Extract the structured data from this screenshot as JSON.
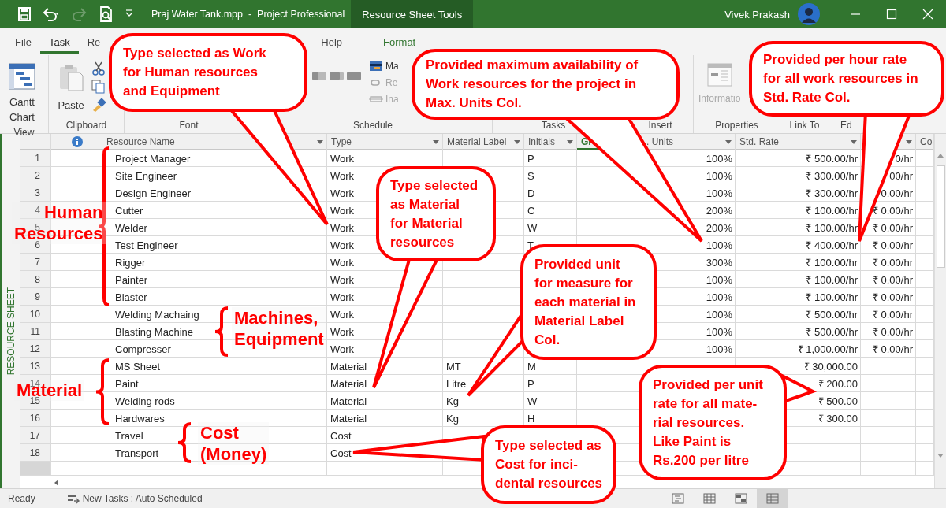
{
  "title_bar": {
    "document_title": "Praj Water Tank.mpp  -  Project Professional",
    "context_tab": "Resource Sheet Tools",
    "user_name": "Vivek Prakash"
  },
  "ribbon": {
    "tabs": [
      {
        "label": "File",
        "selected": false,
        "contextual": false
      },
      {
        "label": "Task",
        "selected": true,
        "contextual": false
      },
      {
        "label": "Re",
        "selected": false,
        "contextual": false
      },
      {
        "label": "Help",
        "selected": false,
        "contextual": false
      },
      {
        "label": "Format",
        "selected": false,
        "contextual": true
      }
    ],
    "groups": [
      {
        "label": "View"
      },
      {
        "label": "Clipboard"
      },
      {
        "label": "Font"
      },
      {
        "label": "Schedule"
      },
      {
        "label": "Tasks"
      },
      {
        "label": "Insert"
      },
      {
        "label": "Properties"
      },
      {
        "label": "Link To"
      },
      {
        "label": "Ed"
      }
    ],
    "commands": {
      "gantt_chart": "Gantt Chart",
      "paste": "Paste",
      "mark_on_track": "Ma",
      "respect_links": "Re",
      "inactivate": "Ina",
      "information": "Informatio"
    }
  },
  "view_label": "RESOURCE SHEET",
  "table": {
    "columns": {
      "resource_name": "Resource Name",
      "type": "Type",
      "material_label": "Material Label",
      "initials": "Initials",
      "group": "Gr",
      "max_units": ". Units",
      "std_rate": "Std. Rate",
      "column_10": "Co"
    },
    "rows": [
      {
        "id": "1",
        "name": "Project Manager",
        "type": "Work",
        "initials": "P",
        "max_units": "100%",
        "std_rate": "₹ 500.00/hr",
        "ovt_rate": "0/hr"
      },
      {
        "id": "2",
        "name": "Site Engineer",
        "type": "Work",
        "initials": "S",
        "max_units": "100%",
        "std_rate": "₹ 300.00/hr",
        "ovt_rate": "00/hr"
      },
      {
        "id": "3",
        "name": "Design Engineer",
        "type": "Work",
        "initials": "D",
        "max_units": "100%",
        "std_rate": "₹ 300.00/hr",
        "ovt_rate": "0.00/hr"
      },
      {
        "id": "4",
        "name": "Cutter",
        "type": "Work",
        "initials": "C",
        "max_units": "200%",
        "std_rate": "₹ 100.00/hr",
        "ovt_rate": "₹ 0.00/hr"
      },
      {
        "id": "5",
        "name": "Welder",
        "type": "Work",
        "initials": "W",
        "max_units": "200%",
        "std_rate": "₹ 100.00/hr",
        "ovt_rate": "₹ 0.00/hr"
      },
      {
        "id": "6",
        "name": "Test Engineer",
        "type": "Work",
        "initials": "T",
        "max_units": "100%",
        "std_rate": "₹ 400.00/hr",
        "ovt_rate": "₹ 0.00/hr"
      },
      {
        "id": "7",
        "name": "Rigger",
        "type": "Work",
        "max_units": "300%",
        "std_rate": "₹ 100.00/hr",
        "ovt_rate": "₹ 0.00/hr"
      },
      {
        "id": "8",
        "name": "Painter",
        "type": "Work",
        "max_units": "100%",
        "std_rate": "₹ 100.00/hr",
        "ovt_rate": "₹ 0.00/hr"
      },
      {
        "id": "9",
        "name": "Blaster",
        "type": "Work",
        "max_units": "100%",
        "std_rate": "₹ 100.00/hr",
        "ovt_rate": "₹ 0.00/hr"
      },
      {
        "id": "10",
        "name": "Welding Machaing",
        "type": "Work",
        "max_units": "100%",
        "std_rate": "₹ 500.00/hr",
        "ovt_rate": "₹ 0.00/hr"
      },
      {
        "id": "11",
        "name": "Blasting Machine",
        "type": "Work",
        "max_units": "100%",
        "std_rate": "₹ 500.00/hr",
        "ovt_rate": "₹ 0.00/hr"
      },
      {
        "id": "12",
        "name": "Compresser",
        "type": "Work",
        "max_units": "100%",
        "std_rate": "₹ 1,000.00/hr",
        "ovt_rate": "₹ 0.00/hr"
      },
      {
        "id": "13",
        "name": "MS Sheet",
        "type": "Material",
        "material_label": "MT",
        "initials": "M",
        "std_rate": "₹ 30,000.00"
      },
      {
        "id": "14",
        "name": "Paint",
        "type": "Material",
        "material_label": "Litre",
        "initials": "P",
        "std_rate": "₹ 200.00"
      },
      {
        "id": "15",
        "name": "Welding rods",
        "type": "Material",
        "material_label": "Kg",
        "initials": "W",
        "std_rate": "₹ 500.00"
      },
      {
        "id": "16",
        "name": "Hardwares",
        "type": "Material",
        "material_label": "Kg",
        "initials": "H",
        "std_rate": "₹ 300.00"
      },
      {
        "id": "17",
        "name": "Travel",
        "type": "Cost"
      },
      {
        "id": "18",
        "name": "Transport",
        "type": "Cost"
      }
    ]
  },
  "annotations": {
    "callouts": [
      {
        "lines": [
          "Type selected as Work",
          "for Human resources",
          "and Equipment"
        ]
      },
      {
        "lines": [
          "Provided maximum availability of",
          "Work resources for the project in",
          "Max. Units Col."
        ]
      },
      {
        "lines": [
          "Provided per hour rate",
          "for all work resources in",
          "Std. Rate Col."
        ]
      },
      {
        "lines": [
          "Type selected",
          "as Material",
          "for Material",
          "resources"
        ]
      },
      {
        "lines": [
          "Provided unit",
          "for measure for",
          "each material in",
          "Material Label",
          "Col."
        ]
      },
      {
        "lines": [
          "Type selected as",
          "Cost for inci-",
          "dental resources"
        ]
      },
      {
        "lines": [
          "Provided per unit",
          "rate for all mate-",
          "rial resources.",
          "Like Paint is",
          "Rs.200 per litre"
        ]
      }
    ],
    "group_labels": [
      {
        "lines": [
          "Human",
          "Resources"
        ]
      },
      {
        "lines": [
          "Machines,",
          "Equipment"
        ]
      },
      {
        "lines": [
          "Material"
        ]
      },
      {
        "lines": [
          "Cost",
          "(Money)"
        ]
      }
    ]
  },
  "status_bar": {
    "mode": "Ready",
    "new_tasks": "New Tasks : Auto Scheduled",
    "view_buttons": [
      {
        "selected": false
      },
      {
        "selected": false
      },
      {
        "selected": false
      },
      {
        "selected": true
      }
    ]
  }
}
